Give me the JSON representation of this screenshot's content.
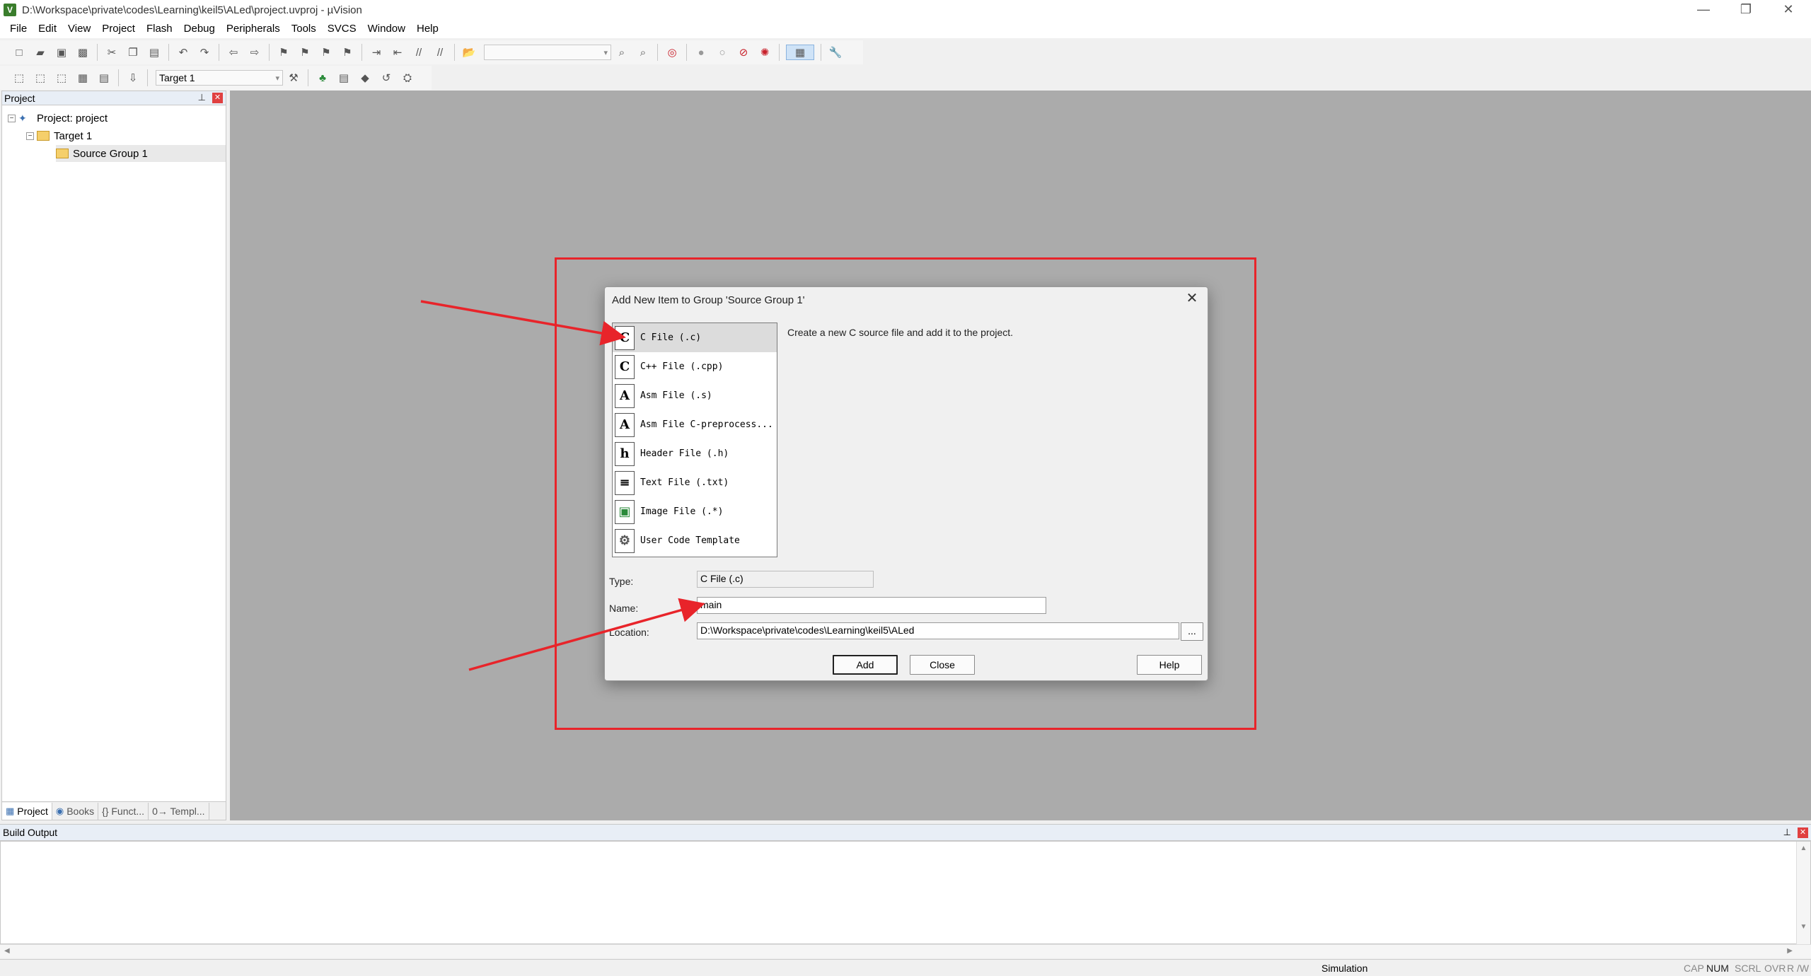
{
  "window": {
    "title": "D:\\Workspace\\private\\codes\\Learning\\keil5\\ALed\\project.uvproj - µVision",
    "app_icon": "V",
    "minimize": "—",
    "restore": "❐",
    "close": "✕"
  },
  "menu": [
    "File",
    "Edit",
    "View",
    "Project",
    "Flash",
    "Debug",
    "Peripherals",
    "Tools",
    "SVCS",
    "Window",
    "Help"
  ],
  "toolbar2": {
    "target_select": "Target 1"
  },
  "project_panel": {
    "title": "Project",
    "tree": {
      "project": "Project: project",
      "target": "Target 1",
      "group": "Source Group 1"
    },
    "tabs": [
      "Project",
      "Books",
      "{} Funct...",
      "0→ Templ..."
    ]
  },
  "dialog": {
    "title": "Add New Item to Group 'Source Group 1'",
    "description": "Create a new C source file and add it to the project.",
    "file_types": [
      {
        "icon": "C",
        "label": "C File (.c)"
      },
      {
        "icon": "C",
        "label": "C++ File (.cpp)"
      },
      {
        "icon": "A",
        "label": "Asm File (.s)"
      },
      {
        "icon": "A",
        "label": "Asm File C-preprocess..."
      },
      {
        "icon": "h",
        "label": "Header File (.h)"
      },
      {
        "icon": "≡",
        "label": "Text File (.txt)"
      },
      {
        "icon": "▣",
        "label": "Image File (.*)"
      },
      {
        "icon": "⚙",
        "label": "User Code Template"
      }
    ],
    "type_label": "Type:",
    "type_value": "C File (.c)",
    "name_label": "Name:",
    "name_value": "main",
    "location_label": "Location:",
    "location_value": "D:\\Workspace\\private\\codes\\Learning\\keil5\\ALed",
    "browse": "...",
    "add_button": "Add",
    "close_button": "Close",
    "help_button": "Help"
  },
  "build_output": {
    "title": "Build Output"
  },
  "status_bar": {
    "mode": "Simulation",
    "indicators": [
      "CAP",
      "NUM",
      "SCRL",
      "OVR",
      "R /W"
    ]
  },
  "colors": {
    "annotation_red": "#e8242a",
    "editor_bg": "#ababab",
    "panel_header": "#e8eef6"
  }
}
